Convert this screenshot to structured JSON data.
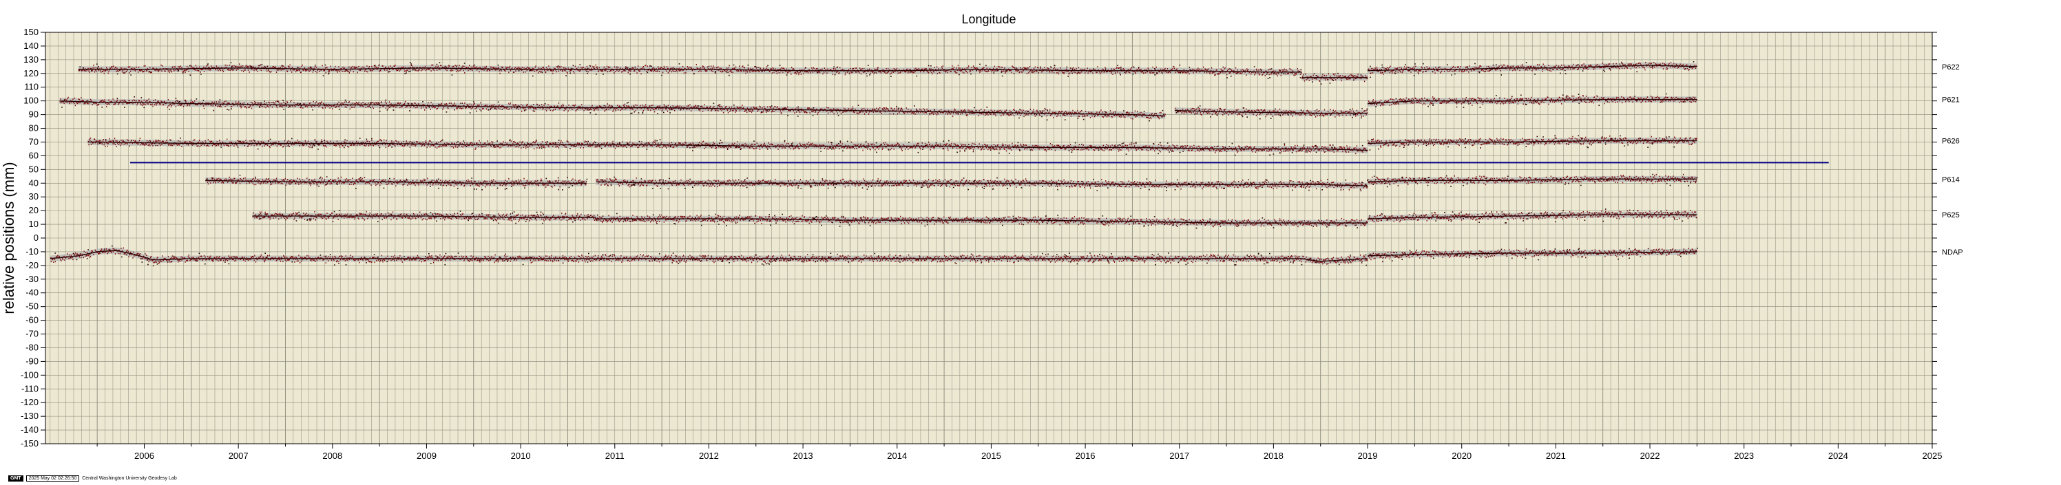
{
  "chart_data": {
    "type": "scatter",
    "title": "Longitude",
    "ylabel": "relative positions (mm)",
    "xlabel": "",
    "xlim": [
      2005.45,
      2025.5
    ],
    "ylim": [
      -150,
      150
    ],
    "x_ticks": [
      "2006",
      "2007",
      "2008",
      "2009",
      "2010",
      "2011",
      "2012",
      "2013",
      "2014",
      "2015",
      "2016",
      "2017",
      "2018",
      "2019",
      "2020",
      "2021",
      "2022",
      "2023",
      "2024",
      "2025"
    ],
    "y_ticks": [
      150,
      140,
      130,
      120,
      110,
      100,
      90,
      80,
      70,
      60,
      50,
      40,
      30,
      20,
      10,
      0,
      -10,
      -20,
      -30,
      -40,
      -50,
      -60,
      -70,
      -80,
      -90,
      -100,
      -110,
      -120,
      -130,
      -140,
      -150
    ],
    "grid": true,
    "colors": {
      "background": "#ece8d2",
      "grid": "#8a8a7a",
      "points": "#7a0c0c",
      "points_dark": "#2a0505",
      "band": "#b8b8b8",
      "line": "#000080"
    },
    "series": [
      {
        "name": "P622",
        "segments": [
          {
            "x": [
              2005.8,
              2006.5,
              2007.5,
              2008.5,
              2009.5,
              2010.5,
              2011.5,
              2012.5,
              2013.5,
              2014.5,
              2015.5,
              2016.5,
              2017.5,
              2018.5,
              2018.8
            ],
            "y": [
              123,
              123,
              124,
              123,
              124,
              123,
              123,
              123,
              122,
              122,
              123,
              122,
              122,
              121,
              121
            ]
          },
          {
            "x": [
              2018.8,
              2019.0,
              2019.5
            ],
            "y": [
              117,
              117,
              117
            ]
          },
          {
            "x": [
              2019.5,
              2020.0,
              2020.5,
              2021.0,
              2021.5,
              2022.0,
              2022.5,
              2023.0
            ],
            "y": [
              122,
              123,
              123,
              124,
              124,
              125,
              126,
              125
            ]
          }
        ]
      },
      {
        "name": "P621",
        "segments": [
          {
            "x": [
              2005.6,
              2006.0,
              2006.5,
              2007.0,
              2008.0,
              2009.0,
              2010.0,
              2011.0,
              2012.0,
              2013.0,
              2014.0,
              2015.0,
              2016.0,
              2017.0,
              2017.35
            ],
            "y": [
              100,
              99,
              99,
              98,
              97,
              97,
              96,
              95,
              95,
              94,
              93,
              92,
              91,
              90,
              89
            ]
          },
          {
            "x": [
              2017.45,
              2018.0,
              2019.0,
              2019.5
            ],
            "y": [
              93,
              92,
              91,
              91
            ]
          },
          {
            "x": [
              2019.5,
              2020.0,
              2021.0,
              2022.0,
              2023.0
            ],
            "y": [
              98,
              100,
              100,
              101,
              101
            ]
          }
        ]
      },
      {
        "name": "P626",
        "segments": [
          {
            "x": [
              2005.9,
              2007.0,
              2008.0,
              2009.0,
              2010.0,
              2011.0,
              2012.0,
              2013.0,
              2014.0,
              2015.0,
              2016.0,
              2017.0,
              2018.0,
              2019.0,
              2019.5
            ],
            "y": [
              70,
              69,
              69,
              69,
              68,
              68,
              68,
              67,
              67,
              67,
              66,
              66,
              65,
              65,
              64
            ]
          },
          {
            "x": [
              2019.5,
              2020.0,
              2021.0,
              2022.0,
              2023.0
            ],
            "y": [
              69,
              70,
              70,
              71,
              71
            ]
          }
        ]
      },
      {
        "name": "P614",
        "segments": [
          {
            "x": [
              2007.15,
              2008.0,
              2009.0,
              2010.0,
              2011.2
            ],
            "y": [
              42,
              41,
              41,
              40,
              40
            ]
          },
          {
            "x": [
              2011.3,
              2012.0,
              2013.0,
              2014.0,
              2015.0,
              2016.0,
              2017.0,
              2018.0,
              2019.0,
              2019.5
            ],
            "y": [
              41,
              40,
              40,
              40,
              40,
              40,
              39,
              39,
              39,
              38
            ]
          },
          {
            "x": [
              2019.5,
              2020.0,
              2021.0,
              2022.0,
              2023.0
            ],
            "y": [
              41,
              42,
              42,
              43,
              43
            ]
          }
        ]
      },
      {
        "name": "P625",
        "segments": [
          {
            "x": [
              2007.65,
              2008.5,
              2009.5,
              2010.5,
              2011.3
            ],
            "y": [
              16,
              16,
              16,
              15,
              15
            ]
          },
          {
            "x": [
              2011.3,
              2012.0,
              2013.0,
              2014.0,
              2015.0,
              2016.0,
              2017.0,
              2018.0,
              2019.0,
              2019.5
            ],
            "y": [
              14,
              14,
              14,
              13,
              13,
              13,
              12,
              11,
              11,
              11
            ]
          },
          {
            "x": [
              2019.5,
              2020.0,
              2021.0,
              2022.0,
              2023.0
            ],
            "y": [
              14,
              15,
              16,
              17,
              17
            ]
          }
        ]
      },
      {
        "name": "NDAP",
        "segments": [
          {
            "x": [
              2005.5,
              2005.8,
              2006.0,
              2006.2,
              2006.4,
              2006.6,
              2007.0,
              2008.0,
              2009.0,
              2010.0,
              2011.0,
              2012.0,
              2013.0,
              2014.0,
              2015.0,
              2016.0,
              2017.0,
              2018.0,
              2018.8,
              2019.0,
              2019.5
            ],
            "y": [
              -15,
              -13,
              -10,
              -9,
              -12,
              -16,
              -15,
              -15,
              -15,
              -15,
              -15,
              -15,
              -15,
              -15,
              -15,
              -15,
              -15,
              -15,
              -15,
              -17,
              -15
            ]
          },
          {
            "x": [
              2019.5,
              2020.0,
              2021.0,
              2022.0,
              2023.0
            ],
            "y": [
              -13,
              -12,
              -11,
              -11,
              -10
            ]
          }
        ]
      }
    ],
    "hline": {
      "y": 55,
      "x": [
        2006.35,
        2024.4
      ]
    },
    "right_labels": [
      "P622",
      "P621",
      "P626",
      "P614",
      "P625",
      "NDAP"
    ]
  },
  "footer": {
    "badge": "GMT",
    "timestamp": "2025 May 02 02:26:50",
    "credit": "Central Washington University Geodesy Lab"
  }
}
